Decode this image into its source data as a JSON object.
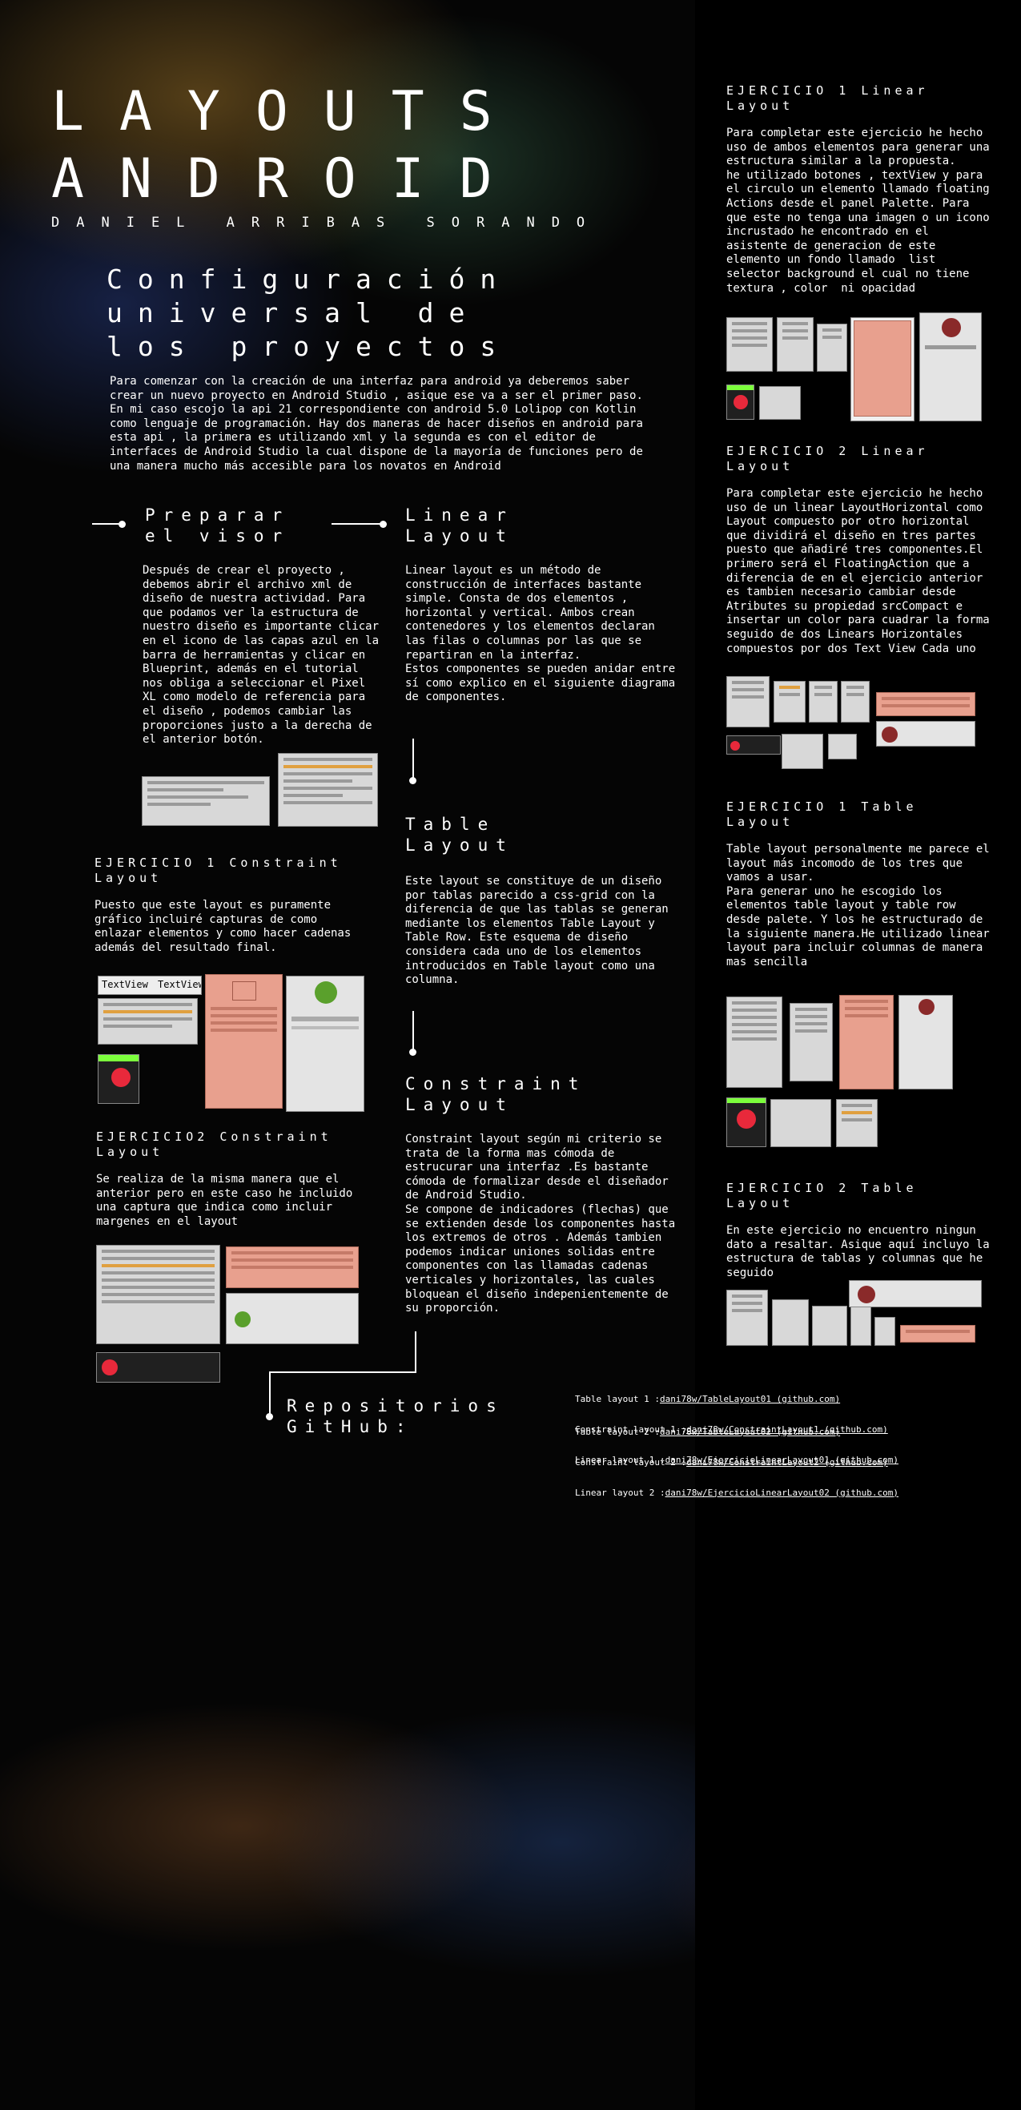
{
  "header": {
    "title_line1": "LAYOUTS",
    "title_line2": "ANDROID",
    "author": "DANIEL ARRIBAS SORANDO"
  },
  "intro": {
    "heading": "Configuración\nuniversal de\nlos proyectos",
    "body": "Para comenzar con la creación de una interfaz para android ya deberemos saber\ncrear un nuevo proyecto en Android Studio , asique ese va a ser el primer paso.\nEn mi caso escojo la api 21 correspondiente con android 5.0 Lolipop con Kotlin\ncomo lenguaje de programación. Hay dos maneras de hacer diseños en android para\nesta api , la primera es utilizando xml y la segunda es con el editor de\ninterfaces de Android Studio la cual dispone de la mayoría de funciones pero de\nuna manera mucho más accesible para los novatos en Android"
  },
  "preparar": {
    "heading": "Preparar\nel visor",
    "body": "Después de crear el proyecto ,\ndebemos abrir el archivo xml de\ndiseño de nuestra actividad. Para\nque podamos ver la estructura de\nnuestro diseño es importante clicar\nen el icono de las capas azul en la\nbarra de herramientas y clicar en\nBlueprint, además en el tutorial\nnos obliga a seleccionar el Pixel\nXL como modelo de referencia para\nel diseño , podemos cambiar las\nproporciones justo a la derecha de\nel anterior botón."
  },
  "linear": {
    "heading": "Linear\nLayout",
    "body": "Linear layout es un método de\nconstrucción de interfaces bastante\nsimple. Consta de dos elementos ,\nhorizontal y vertical. Ambos crean\ncontenedores y los elementos declaran\nlas filas o columnas por las que se\nrepartiran en la interfaz.\nEstos componentes se pueden anidar entre\nsí como explico en el siguiente diagrama\nde componentes."
  },
  "table": {
    "heading": "Table\nLayout",
    "body": "Este layout se constituye de un diseño\npor tablas parecido a css-grid con la\ndiferencia de que las tablas se generan\nmediante los elementos Table Layout y\nTable Row. Este esquema de diseño\nconsidera cada uno de los elementos\nintroducidos en Table layout como una\ncolumna."
  },
  "constraint": {
    "heading": "Constraint\nLayout",
    "body": "Constraint layout según mi criterio se\ntrata de la forma mas cómoda de\nestrucurar una interfaz .Es bastante\ncómoda de formalizar desde el diseñador\nde Android Studio.\nSe compone de indicadores (flechas) que\nse extienden desde los componentes hasta\nlos extremos de otros . Además tambien\npodemos indicar uniones solidas entre\ncomponentes con las llamadas cadenas\nverticales y horizontales, las cuales\nbloquean el diseño indepenientemente de\nsu proporción."
  },
  "constraint_ex1": {
    "heading": "EJERCICIO 1 Constraint\nLayout",
    "body": "Puesto que este layout es puramente\ngráfico incluiré capturas de como\nenlazar elementos y como hacer cadenas\nademás del resultado final.",
    "shot_text1": "TextView",
    "shot_text2": "TextView"
  },
  "constraint_ex2": {
    "heading": "EJERCICIO2 Constraint\nLayout",
    "body": "Se realiza de la misma manera que el\nanterior pero en este caso he incluido\nuna captura que indica como incluir\nmargenes en el layout"
  },
  "linear_ex1": {
    "heading": "EJERCICIO 1 Linear\nLayout",
    "body": "Para completar este ejercicio he hecho\nuso de ambos elementos para generar una\nestructura similar a la propuesta.\nhe utilizado botones , textView y para\nel circulo un elemento llamado floating\nActions desde el panel Palette. Para\nque este no tenga una imagen o un icono\nincrustado he encontrado en el\nasistente de generacion de este\nelemento un fondo llamado  list\nselector background el cual no tiene\ntextura , color  ni opacidad"
  },
  "linear_ex2": {
    "heading": "EJERCICIO 2 Linear\nLayout",
    "body": "Para completar este ejercicio he hecho\nuso de un linear LayoutHorizontal como\nLayout compuesto por otro horizontal\nque dividirá el diseño en tres partes\npuesto que añadiré tres componentes.El\nprimero será el FloatingAction que a\ndiferencia de en el ejercicio anterior\nes tambien necesario cambiar desde\nAtributes su propiedad srcCompact e\ninsertar un color para cuadrar la forma\nseguido de dos Linears Horizontales\ncompuestos por dos Text View Cada uno"
  },
  "table_ex1": {
    "heading": "EJERCICIO 1 Table\nLayout",
    "body": "Table layout personalmente me parece el\nlayout más incomodo de los tres que\nvamos a usar.\nPara generar uno he escogido los\nelementos table layout y table row\ndesde palete. Y los he estructurado de\nla siguiente manera.He utilizado linear\nlayout para incluir columnas de manera\nmas sencilla"
  },
  "table_ex2": {
    "heading": "EJERCICIO 2 Table\nLayout",
    "body": "En este ejercicio no encuentro ningun\ndato a resaltar. Asique aquí incluyo la\nestructura de tablas y columnas que he\nseguido"
  },
  "repos": {
    "heading": "Repositorios\nGitHub:",
    "groups": [
      [
        {
          "label": "Table layout 1 :",
          "link": "dani78w/TableLayout01 (github.com)"
        },
        {
          "label": "Table layout 2 :",
          "link": "dani78w/TableLayout02 (github.com)"
        }
      ],
      [
        {
          "label": "Constraint layout 1 :",
          "link": "dani78w/ConstraintLayout1 (github.com)"
        },
        {
          "label": "Constraint layout 2 :",
          "link": "dani78w/ConstraintLayout2 (github.com)"
        }
      ],
      [
        {
          "label": "Linear layout 1 :",
          "link": "dani78w/EjercicioLinearLayout01 (github.com)"
        },
        {
          "label": "Linear layout 2 :",
          "link": "dani78w/EjercicioLinearLayout02 (github.com)"
        }
      ]
    ]
  },
  "colors": {
    "background": "#000000",
    "text": "#ffffff",
    "accent_red": "#e8293b",
    "accent_green": "#5aa02c",
    "salmon": "#e8a08e"
  }
}
